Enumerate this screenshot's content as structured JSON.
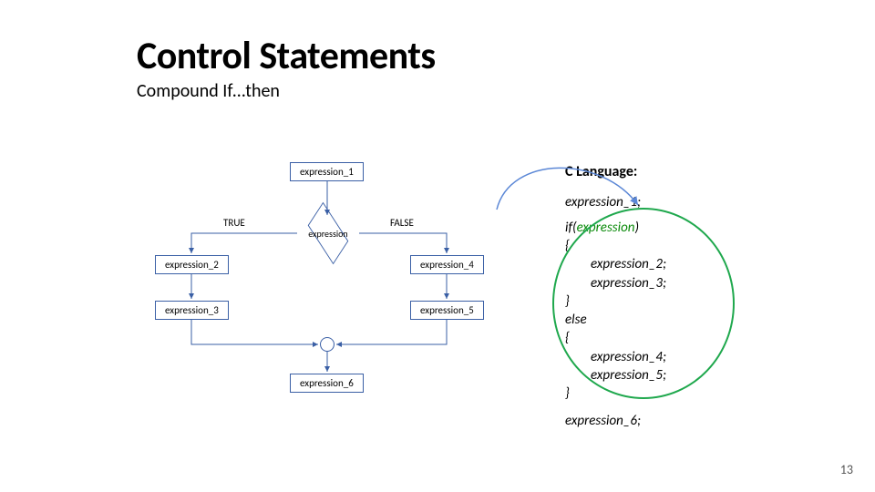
{
  "title": "Control Statements",
  "subtitle": "Compound If…then",
  "page_number": "13",
  "flow": {
    "top_box": "expression_1",
    "decision": "expression",
    "true_label": "TRUE",
    "false_label": "FALSE",
    "left_a": "expression_2",
    "left_b": "expression_3",
    "right_a": "expression_4",
    "right_b": "expression_5",
    "bottom_box": "expression_6"
  },
  "code": {
    "title": "C Language:",
    "l1": "expression_1;",
    "l2a": "if(",
    "l2b": "expression",
    "l2c": ")",
    "l3": "{",
    "l4": "expression_2;",
    "l5": "expression_3;",
    "l6": "}",
    "l7": "else",
    "l8": "{",
    "l9": "expression_4;",
    "l10": "expression_5;",
    "l11": "}",
    "l12": "expression_6;"
  }
}
